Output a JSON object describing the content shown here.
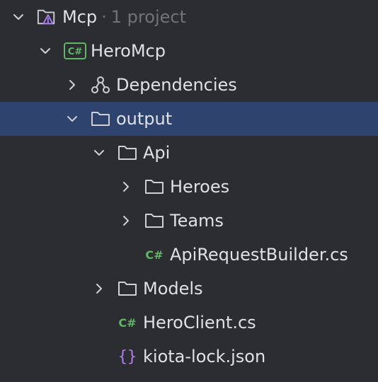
{
  "tree": {
    "root": {
      "label": "Mcp",
      "separator": "·",
      "hint": "1 project"
    },
    "project": {
      "label": "HeroMcp",
      "badge": "C#"
    },
    "dependencies": {
      "label": "Dependencies"
    },
    "output": {
      "label": "output"
    },
    "api": {
      "label": "Api"
    },
    "heroes": {
      "label": "Heroes"
    },
    "teams": {
      "label": "Teams"
    },
    "api_request_builder": {
      "label": "ApiRequestBuilder.cs",
      "icon_text": "C#"
    },
    "models": {
      "label": "Models"
    },
    "hero_client": {
      "label": "HeroClient.cs",
      "icon_text": "C#"
    },
    "kiota_lock": {
      "label": "kiota-lock.json",
      "icon_text": "{}"
    }
  },
  "colors": {
    "background": "#2b2d30",
    "selection": "#2e436e",
    "text": "#dfe1e5",
    "muted": "#6f737a",
    "csharp": "#5fb865",
    "json": "#b07cf0",
    "solution_accent": "#a883f5"
  },
  "icons": {
    "solution": "solution-folder-icon",
    "project": "csharp-project-icon",
    "dependencies": "dependencies-icon",
    "folder": "folder-icon",
    "csharp_file": "csharp-file-icon",
    "json_file": "json-file-icon"
  }
}
